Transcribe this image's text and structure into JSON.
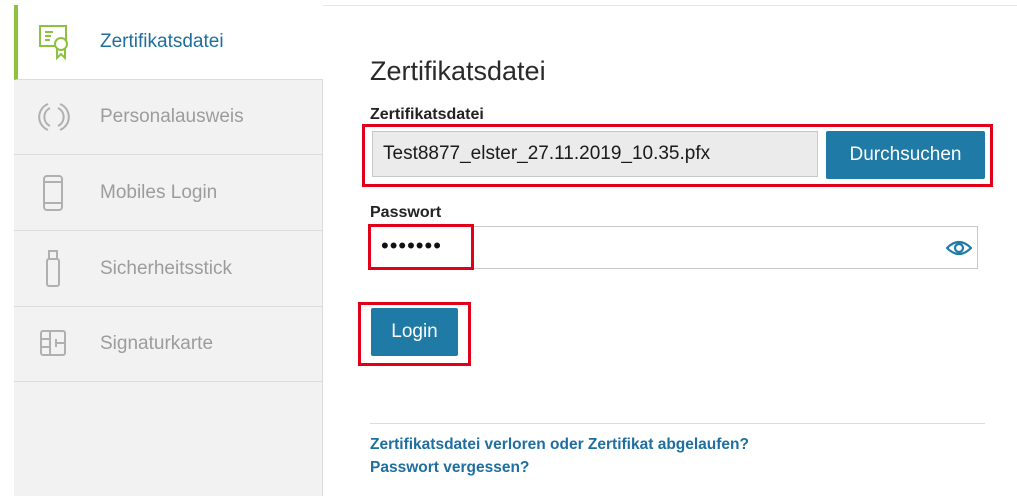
{
  "sidebar": {
    "items": [
      {
        "label": "Zertifikatsdatei",
        "icon": "certificate-icon",
        "active": true
      },
      {
        "label": "Personalausweis",
        "icon": "id-card-icon",
        "active": false
      },
      {
        "label": "Mobiles Login",
        "icon": "mobile-phone-icon",
        "active": false
      },
      {
        "label": "Sicherheitsstick",
        "icon": "usb-stick-icon",
        "active": false
      },
      {
        "label": "Signaturkarte",
        "icon": "chip-card-icon",
        "active": false
      }
    ]
  },
  "main": {
    "title": "Zertifikatsdatei",
    "file_label": "Zertifikatsdatei",
    "file_value": "Test8877_elster_27.11.2019_10.35.pfx",
    "browse_label": "Durchsuchen",
    "password_label": "Passwort",
    "password_masked": "•••••••",
    "login_label": "Login",
    "links": [
      "Zertifikatsdatei verloren oder Zertifikat abgelaufen?",
      "Passwort vergessen?"
    ]
  },
  "colors": {
    "accent": "#1f7aa6",
    "active_bar": "#8cc23e",
    "highlight": "#e0001a",
    "link": "#1e6f9f"
  }
}
